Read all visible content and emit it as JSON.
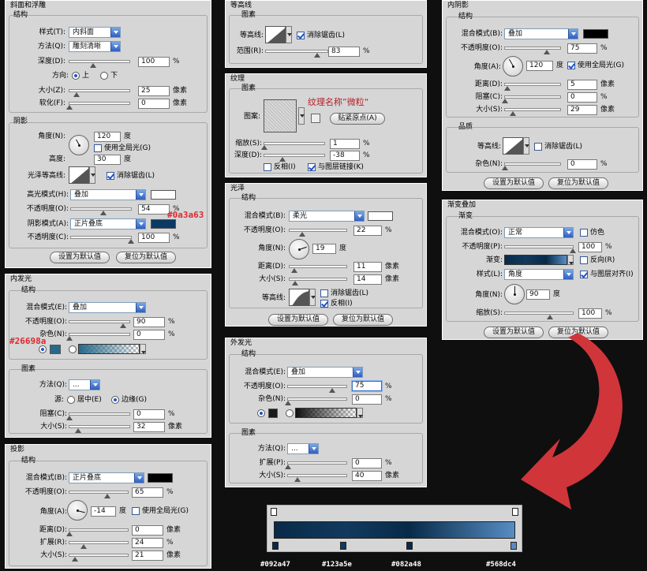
{
  "bevel": {
    "title": "斜面和浮雕",
    "structure_title": "结构",
    "style_label": "样式(T):",
    "style_value": "内斜面",
    "method_label": "方法(Q):",
    "method_value": "雕刻清晰",
    "depth_label": "深度(D):",
    "depth_value": "100",
    "depth_unit": "%",
    "direction_label": "方向:",
    "dir_up": "上",
    "dir_down": "下",
    "size_label": "大小(Z):",
    "size_value": "25",
    "size_unit": "像素",
    "soften_label": "软化(F):",
    "soften_value": "0",
    "soften_unit": "像素",
    "shading_title": "阴影",
    "angle_label": "角度(N):",
    "angle_value": "120",
    "angle_unit": "度",
    "global_light": "使用全局光(G)",
    "altitude_label": "高度:",
    "altitude_value": "30",
    "altitude_unit": "度",
    "gloss_label": "光泽等高线:",
    "antialias": "消除锯齿(L)",
    "highlight_label": "高光模式(H):",
    "highlight_value": "叠加",
    "h_opacity_label": "不透明度(O):",
    "h_opacity_value": "54",
    "h_opacity_unit": "%",
    "shadow_label": "阴影模式(A):",
    "shadow_value": "正片叠底",
    "s_opacity_label": "不透明度(C):",
    "s_opacity_value": "100",
    "s_opacity_unit": "%",
    "default_btn": "设置为默认值",
    "reset_btn": "复位为默认值",
    "highlight_color": "#ffffff",
    "shadow_color": "#0a3a63",
    "annotation": "#0a3a63"
  },
  "contour": {
    "title": "等高线",
    "section": "图素",
    "label": "等高线:",
    "antialias": "消除锯齿(L)",
    "range_label": "范围(R):",
    "range_value": "83",
    "range_unit": "%"
  },
  "texture": {
    "title": "纹理",
    "section": "图素",
    "pattern_label": "图案:",
    "pattern_name": "纹理名称”微粒“",
    "snap_btn": "贴紧原点(A)",
    "scale_label": "缩放(S):",
    "scale_value": "1",
    "scale_unit": "%",
    "depth_label": "深度(D):",
    "depth_value": "-38",
    "depth_unit": "%",
    "invert": "反相(I)",
    "link": "与图层链接(K)"
  },
  "satin": {
    "title": "光泽",
    "structure_title": "结构",
    "blend_label": "混合模式(B):",
    "blend_value": "柔光",
    "opacity_label": "不透明度(O):",
    "opacity_value": "22",
    "opacity_unit": "%",
    "angle_label": "角度(N):",
    "angle_value": "19",
    "angle_unit": "度",
    "distance_label": "距离(D):",
    "distance_value": "11",
    "distance_unit": "像素",
    "size_label": "大小(S):",
    "size_value": "14",
    "size_unit": "像素",
    "contour_label": "等高线:",
    "antialias": "消除锯齿(L)",
    "invert": "反相(I)",
    "default_btn": "设置为默认值",
    "reset_btn": "复位为默认值",
    "color": "#ffffff"
  },
  "inner_shadow": {
    "title": "内阴影",
    "structure_title": "结构",
    "blend_label": "混合模式(B):",
    "blend_value": "叠加",
    "opacity_label": "不透明度(O):",
    "opacity_value": "75",
    "opacity_unit": "%",
    "angle_label": "角度(A):",
    "angle_value": "120",
    "angle_unit": "度",
    "global_light": "使用全局光(G)",
    "distance_label": "距离(D):",
    "distance_value": "5",
    "distance_unit": "像素",
    "choke_label": "阻塞(C):",
    "choke_value": "0",
    "choke_unit": "%",
    "size_label": "大小(S):",
    "size_value": "29",
    "size_unit": "像素",
    "quality_title": "品质",
    "contour_label": "等高线:",
    "antialias": "消除锯齿(L)",
    "noise_label": "杂色(N):",
    "noise_value": "0",
    "noise_unit": "%",
    "default_btn": "设置为默认值",
    "reset_btn": "复位为默认值",
    "color": "#000000"
  },
  "gradient_overlay": {
    "title": "渐变叠加",
    "section": "渐变",
    "blend_label": "混合模式(O):",
    "blend_value": "正常",
    "dither": "仿色",
    "opacity_label": "不透明度(P):",
    "opacity_value": "100",
    "opacity_unit": "%",
    "gradient_label": "渐变:",
    "reverse": "反向(R)",
    "style_label": "样式(L):",
    "style_value": "角度",
    "align": "与图层对齐(I)",
    "angle_label": "角度(N):",
    "angle_value": "90",
    "angle_unit": "度",
    "scale_label": "缩放(S):",
    "scale_value": "100",
    "scale_unit": "%",
    "default_btn": "设置为默认值",
    "reset_btn": "复位为默认值"
  },
  "inner_glow": {
    "title": "内发光",
    "structure_title": "结构",
    "blend_label": "混合模式(E):",
    "blend_value": "叠加",
    "opacity_label": "不透明度(O):",
    "opacity_value": "90",
    "opacity_unit": "%",
    "noise_label": "杂色(N):",
    "noise_value": "0",
    "noise_unit": "%",
    "elements_title": "图素",
    "method_label": "方法(Q):",
    "method_value": "...",
    "source_label": "源:",
    "center": "居中(E)",
    "edge": "边缘(G)",
    "choke_label": "阻塞(C):",
    "choke_value": "0",
    "choke_unit": "%",
    "size_label": "大小(S):",
    "size_value": "32",
    "size_unit": "像素",
    "color": "#26698a",
    "annotation": "#26698a"
  },
  "outer_glow": {
    "title": "外发光",
    "structure_title": "结构",
    "blend_label": "混合模式(E):",
    "blend_value": "叠加",
    "opacity_label": "不透明度(O):",
    "opacity_value": "75",
    "opacity_unit": "%",
    "noise_label": "杂色(N):",
    "noise_value": "0",
    "noise_unit": "%",
    "elements_title": "图素",
    "method_label": "方法(Q):",
    "method_value": "...",
    "spread_label": "扩展(P):",
    "spread_value": "0",
    "spread_unit": "%",
    "size_label": "大小(S):",
    "size_value": "40",
    "size_unit": "像素",
    "color": "#1a1a1a"
  },
  "drop_shadow": {
    "title": "投影",
    "structure_title": "结构",
    "blend_label": "混合模式(B):",
    "blend_value": "正片叠底",
    "opacity_label": "不透明度(O):",
    "opacity_value": "65",
    "opacity_unit": "%",
    "angle_label": "角度(A):",
    "angle_value": "-14",
    "angle_unit": "度",
    "global_light": "使用全局光(G)",
    "distance_label": "距离(D):",
    "distance_value": "0",
    "distance_unit": "像素",
    "spread_label": "扩展(R):",
    "spread_value": "24",
    "spread_unit": "%",
    "size_label": "大小(S):",
    "size_value": "21",
    "size_unit": "像素",
    "color": "#000000"
  },
  "gradient_bar": {
    "stop1": "#092a47",
    "stop2": "#123a5e",
    "stop3": "#082a48",
    "stop4": "#568dc4"
  },
  "arrow_color": "#d0353a"
}
